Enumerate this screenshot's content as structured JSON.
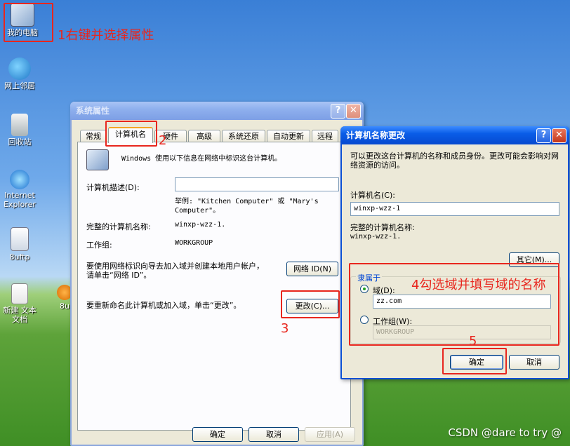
{
  "desktop": {
    "icons": [
      {
        "label": "我的电脑"
      },
      {
        "label": "网上邻居"
      },
      {
        "label": "回收站"
      },
      {
        "label": "Internet Explorer"
      },
      {
        "label": "8uftp"
      },
      {
        "label": "新建 文本文档"
      },
      {
        "label": "8u"
      }
    ]
  },
  "annotations": {
    "step1": "1右键并选择属性",
    "step2": "2",
    "step3": "3",
    "step4": "4勾选域并填写域的名称",
    "step5": "5"
  },
  "sys_props": {
    "title": "系统属性",
    "help_btn": "?",
    "close_btn": "✕",
    "tabs": [
      "常规",
      "计算机名",
      "硬件",
      "高级",
      "系统还原",
      "自动更新",
      "远程"
    ],
    "intro": "Windows 使用以下信息在网络中标识这台计算机。",
    "desc_label": "计算机描述(D):",
    "desc_value": "",
    "example": "举例: \"Kitchen Computer\" 或 \"Mary's Computer\"。",
    "fullname_label": "完整的计算机名称:",
    "fullname_value": "winxp-wzz-1.",
    "workgroup_label": "工作组:",
    "workgroup_value": "WORKGROUP",
    "netid_text": "要使用网络标识向导去加入域并创建本地用户帐户，请单击“网络 ID”。",
    "netid_btn": "网络 ID(N)",
    "rename_text": "要重新命名此计算机或加入域，单击“更改”。",
    "change_btn": "更改(C)...",
    "ok_btn": "确定",
    "cancel_btn": "取消",
    "apply_btn": "应用(A)"
  },
  "rename_dialog": {
    "title": "计算机名称更改",
    "help_btn": "?",
    "close_btn": "✕",
    "intro": "可以更改这台计算机的名称和成员身份。更改可能会影响对网络资源的访问。",
    "name_label": "计算机名(C):",
    "name_value": "winxp-wzz-1",
    "fullname_label": "完整的计算机名称:",
    "fullname_value": "winxp-wzz-1.",
    "other_btn": "其它(M)...",
    "member_group": "隶属于",
    "domain_label": "域(D):",
    "domain_value": "zz.com",
    "domain_selected": true,
    "workgroup_label": "工作组(W):",
    "workgroup_value": "WORKGROUP",
    "ok_btn": "确定",
    "cancel_btn": "取消"
  },
  "watermark": "CSDN @dare to try @"
}
